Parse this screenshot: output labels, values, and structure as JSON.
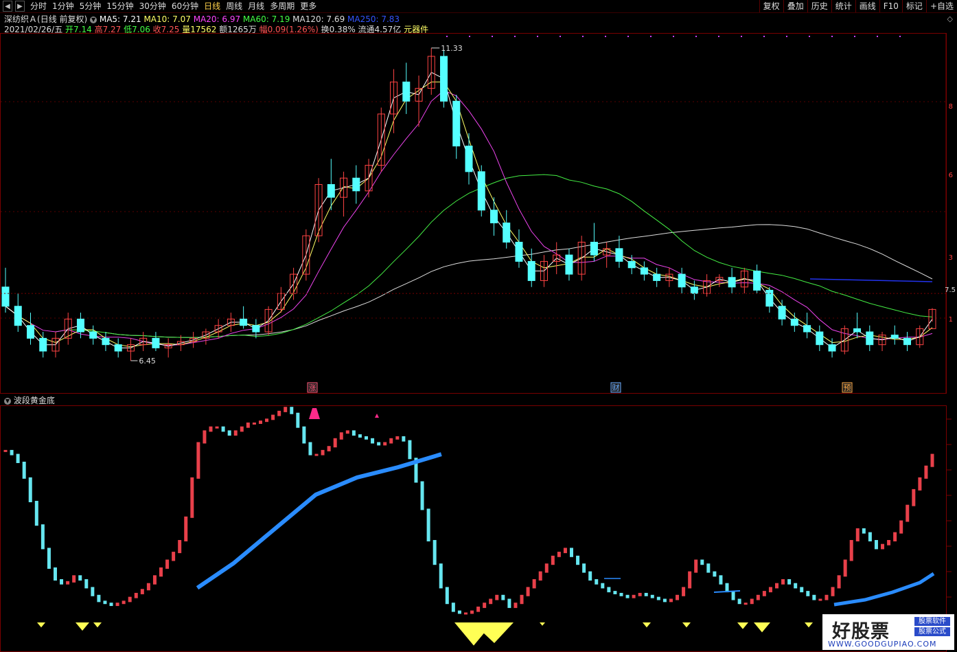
{
  "toolbar": {
    "tabs": [
      "分时",
      "1分钟",
      "5分钟",
      "15分钟",
      "30分钟",
      "60分钟",
      "日线",
      "周线",
      "月线",
      "多周期",
      "更多"
    ],
    "active_tab": "日线",
    "right_buttons": [
      "复权",
      "叠加",
      "历史",
      "统计",
      "画线",
      "F10",
      "标记",
      "+自选"
    ]
  },
  "header": {
    "stock_name": "深纺织Ａ",
    "mode": "(日线 前复权)",
    "ma": [
      {
        "label": "MA5: 7.21",
        "color": "#ffffff"
      },
      {
        "label": "MA10: 7.07",
        "color": "#ffff66"
      },
      {
        "label": "MA20: 6.97",
        "color": "#ff44ff"
      },
      {
        "label": "MA60: 7.19",
        "color": "#44ff44"
      },
      {
        "label": "MA120: 7.69",
        "color": "#dddddd"
      },
      {
        "label": "MA250: 7.83",
        "color": "#3355ff"
      }
    ],
    "quote": [
      {
        "text": "2021/02/26/五",
        "color": "#dddddd"
      },
      {
        "text": "开7.14",
        "color": "#44ff44"
      },
      {
        "text": "高7.27",
        "color": "#ff5555"
      },
      {
        "text": "低7.06",
        "color": "#44ff44"
      },
      {
        "text": "收7.25",
        "color": "#ff5555"
      },
      {
        "text": "量17562",
        "color": "#ffff66"
      },
      {
        "text": "额1265万",
        "color": "#dddddd"
      },
      {
        "text": "幅0.09(1.26%)",
        "color": "#ff5555"
      },
      {
        "text": "换0.38%",
        "color": "#dddddd"
      },
      {
        "text": "流通4.57亿",
        "color": "#dddddd"
      },
      {
        "text": "元器件",
        "color": "#ffff66"
      }
    ]
  },
  "main_chart": {
    "high_label": "11.33",
    "low_label": "6.45",
    "price_tag": "7.5",
    "right_axis_marks": [
      "8",
      "6",
      "3",
      "1"
    ],
    "event_markers": [
      {
        "label": "涨",
        "color": "#ff5577"
      },
      {
        "label": "财",
        "color": "#66aaff"
      },
      {
        "label": "预",
        "color": "#ffaa44"
      }
    ]
  },
  "sub_chart": {
    "indicator_name": "波段黄金底"
  },
  "watermark": {
    "logo": "好股票",
    "tag1": "股票软件",
    "tag2": "股票公式",
    "url": "WWW.GOODGUPIAO.COM"
  },
  "colors": {
    "up_candle": "#ff4444",
    "down_candle": "#54ffff",
    "panel_border": "#7a0000",
    "sub_red": "#e8404a",
    "sub_cyan": "#66e6f0",
    "sub_blue": "#2a8cff",
    "sub_yellow": "#ffff55",
    "sub_magenta": "#ff2a8a"
  },
  "chart_data": {
    "type": "candlestick",
    "series": [
      {
        "name": "K",
        "values": [
          [
            7.6,
            7.9,
            7.2,
            7.3
          ],
          [
            7.3,
            7.5,
            6.9,
            7.0
          ],
          [
            7.0,
            7.2,
            6.7,
            6.8
          ],
          [
            6.8,
            6.9,
            6.5,
            6.6
          ],
          [
            6.6,
            6.9,
            6.5,
            6.8
          ],
          [
            6.8,
            7.2,
            6.7,
            7.1
          ],
          [
            7.1,
            7.2,
            6.8,
            6.9
          ],
          [
            6.9,
            7.0,
            6.7,
            6.8
          ],
          [
            6.8,
            6.9,
            6.6,
            6.7
          ],
          [
            6.7,
            6.8,
            6.5,
            6.6
          ],
          [
            6.6,
            6.8,
            6.45,
            6.7
          ],
          [
            6.7,
            6.9,
            6.6,
            6.8
          ],
          [
            6.8,
            6.9,
            6.6,
            6.65
          ],
          [
            6.65,
            6.8,
            6.5,
            6.7
          ],
          [
            6.7,
            6.85,
            6.6,
            6.75
          ],
          [
            6.75,
            6.9,
            6.65,
            6.8
          ],
          [
            6.8,
            6.95,
            6.7,
            6.9
          ],
          [
            6.9,
            7.1,
            6.8,
            7.0
          ],
          [
            7.0,
            7.2,
            6.9,
            7.1
          ],
          [
            7.1,
            7.3,
            6.95,
            7.0
          ],
          [
            7.0,
            7.1,
            6.8,
            6.9
          ],
          [
            6.9,
            7.3,
            6.85,
            7.25
          ],
          [
            7.25,
            7.6,
            7.2,
            7.5
          ],
          [
            7.5,
            7.9,
            7.4,
            7.8
          ],
          [
            7.8,
            8.5,
            7.7,
            8.4
          ],
          [
            8.4,
            9.3,
            8.3,
            9.2
          ],
          [
            9.2,
            9.6,
            8.8,
            9.0
          ],
          [
            9.0,
            9.4,
            8.7,
            9.3
          ],
          [
            9.3,
            9.5,
            8.9,
            9.1
          ],
          [
            9.1,
            9.6,
            9.0,
            9.5
          ],
          [
            9.5,
            10.4,
            9.4,
            10.3
          ],
          [
            10.3,
            11.0,
            10.0,
            10.8
          ],
          [
            10.8,
            11.1,
            10.3,
            10.5
          ],
          [
            10.5,
            10.9,
            10.1,
            10.7
          ],
          [
            10.7,
            11.33,
            10.6,
            11.2
          ],
          [
            11.2,
            11.3,
            10.4,
            10.5
          ],
          [
            10.5,
            10.6,
            9.6,
            9.8
          ],
          [
            9.8,
            10.0,
            9.2,
            9.4
          ],
          [
            9.4,
            9.5,
            8.7,
            8.8
          ],
          [
            8.8,
            9.0,
            8.4,
            8.6
          ],
          [
            8.6,
            8.8,
            8.2,
            8.3
          ],
          [
            8.3,
            8.5,
            7.9,
            8.0
          ],
          [
            8.0,
            8.2,
            7.6,
            7.7
          ],
          [
            7.7,
            8.1,
            7.6,
            8.0
          ],
          [
            8.0,
            8.3,
            7.8,
            8.1
          ],
          [
            8.1,
            8.2,
            7.7,
            7.8
          ],
          [
            7.8,
            8.4,
            7.7,
            8.3
          ],
          [
            8.3,
            8.6,
            8.0,
            8.1
          ],
          [
            8.1,
            8.3,
            7.9,
            8.2
          ],
          [
            8.2,
            8.4,
            7.9,
            8.0
          ],
          [
            8.0,
            8.1,
            7.8,
            7.9
          ],
          [
            7.9,
            8.0,
            7.7,
            7.8
          ],
          [
            7.8,
            7.9,
            7.6,
            7.7
          ],
          [
            7.7,
            7.9,
            7.6,
            7.8
          ],
          [
            7.8,
            7.9,
            7.5,
            7.6
          ],
          [
            7.6,
            7.7,
            7.4,
            7.5
          ],
          [
            7.5,
            7.8,
            7.45,
            7.7
          ],
          [
            7.7,
            7.8,
            7.6,
            7.75
          ],
          [
            7.75,
            7.9,
            7.5,
            7.6
          ],
          [
            7.6,
            7.9,
            7.5,
            7.85
          ],
          [
            7.85,
            7.95,
            7.5,
            7.55
          ],
          [
            7.55,
            7.6,
            7.2,
            7.3
          ],
          [
            7.3,
            7.4,
            7.0,
            7.1
          ],
          [
            7.1,
            7.2,
            6.9,
            7.0
          ],
          [
            7.0,
            7.2,
            6.8,
            6.9
          ],
          [
            6.9,
            7.0,
            6.6,
            6.7
          ],
          [
            6.7,
            6.8,
            6.5,
            6.6
          ],
          [
            6.6,
            7.0,
            6.55,
            6.95
          ],
          [
            6.95,
            7.2,
            6.8,
            6.9
          ],
          [
            6.9,
            7.0,
            6.6,
            6.7
          ],
          [
            6.7,
            6.9,
            6.6,
            6.85
          ],
          [
            6.85,
            7.0,
            6.7,
            6.8
          ],
          [
            6.8,
            6.9,
            6.6,
            6.7
          ],
          [
            6.7,
            7.0,
            6.65,
            6.95
          ],
          [
            6.95,
            7.27,
            7.06,
            7.25
          ]
        ]
      }
    ],
    "ylim": [
      6.3,
      11.5
    ]
  }
}
